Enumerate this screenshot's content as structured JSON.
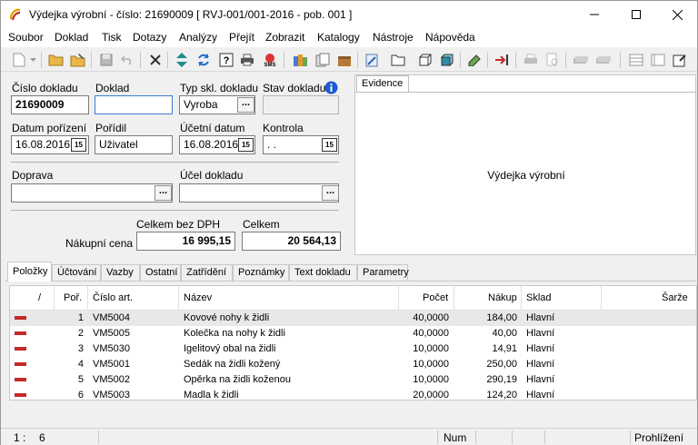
{
  "window": {
    "title": "Výdejka výrobní - číslo: 21690009  [ RVJ-001/001-2016 - pob. 001 ]"
  },
  "menu": [
    "Soubor",
    "Doklad",
    "Tisk",
    "Dotazy",
    "Analýzy",
    "Přejít",
    "Zobrazit",
    "Katalogy",
    "Nástroje",
    "Nápověda"
  ],
  "form": {
    "cislo_label": "Číslo dokladu",
    "cislo_value": "21690009",
    "doklad_label": "Doklad",
    "doklad_value": "",
    "typ_label": "Typ skl. dokladu",
    "typ_value": "Vyroba",
    "stav_label": "Stav dokladu",
    "stav_value": "",
    "datum_label": "Datum pořízení",
    "datum_value": "16.08.2016",
    "poridil_label": "Pořídil",
    "poridil_value": "Uživatel",
    "ucetni_label": "Účetní datum",
    "ucetni_value": "16.08.2016",
    "kontrola_label": "Kontrola",
    "kontrola_value": ". .",
    "doprava_label": "Doprava",
    "doprava_value": "",
    "ucel_label": "Účel dokladu",
    "ucel_value": "",
    "celkem_bez_label": "Celkem bez DPH",
    "celkem_label": "Celkem",
    "nakupni_label": "Nákupní cena",
    "celkem_bez_value": "16 995,15",
    "celkem_value": "20 564,13",
    "dots": "...",
    "cal": "15"
  },
  "evidence": {
    "tab": "Evidence",
    "text": "Výdejka výrobní"
  },
  "tabs": [
    "Položky",
    "Účtování",
    "Vazby",
    "Ostatní",
    "Zatřídění",
    "Poznámky",
    "Text dokladu",
    "Parametry"
  ],
  "grid": {
    "headers": {
      "sort": "/",
      "por": "Poř.",
      "cislo": "Číslo art.",
      "nazev": "Název",
      "pocet": "Počet",
      "nakup": "Nákup",
      "sklad": "Sklad",
      "sarze": "Šarže"
    },
    "rows": [
      {
        "por": "1",
        "cislo": "VM5004",
        "nazev": "Kovové nohy k židli",
        "pocet": "40,0000",
        "nakup": "184,00",
        "sklad": "Hlavní"
      },
      {
        "por": "2",
        "cislo": "VM5005",
        "nazev": "Kolečka na nohy k židli",
        "pocet": "40,0000",
        "nakup": "40,00",
        "sklad": "Hlavní"
      },
      {
        "por": "3",
        "cislo": "VM5030",
        "nazev": "Igelitový obal na židli",
        "pocet": "10,0000",
        "nakup": "14,91",
        "sklad": "Hlavní"
      },
      {
        "por": "4",
        "cislo": "VM5001",
        "nazev": "Sedák na židli kožený",
        "pocet": "10,0000",
        "nakup": "250,00",
        "sklad": "Hlavní"
      },
      {
        "por": "5",
        "cislo": "VM5002",
        "nazev": "Opěrka na židli koženou",
        "pocet": "10,0000",
        "nakup": "290,19",
        "sklad": "Hlavní"
      },
      {
        "por": "6",
        "cislo": "VM5003",
        "nazev": "Madla k židli",
        "pocet": "20,0000",
        "nakup": "124,20",
        "sklad": "Hlavní"
      }
    ]
  },
  "status": {
    "row_label": "1 :",
    "row_value": "6",
    "num": "Num",
    "mode": "Prohlížení"
  },
  "colors": {
    "accent": "#3b7ccf",
    "row_marker": "#c62828",
    "info": "#1a5bd6"
  }
}
